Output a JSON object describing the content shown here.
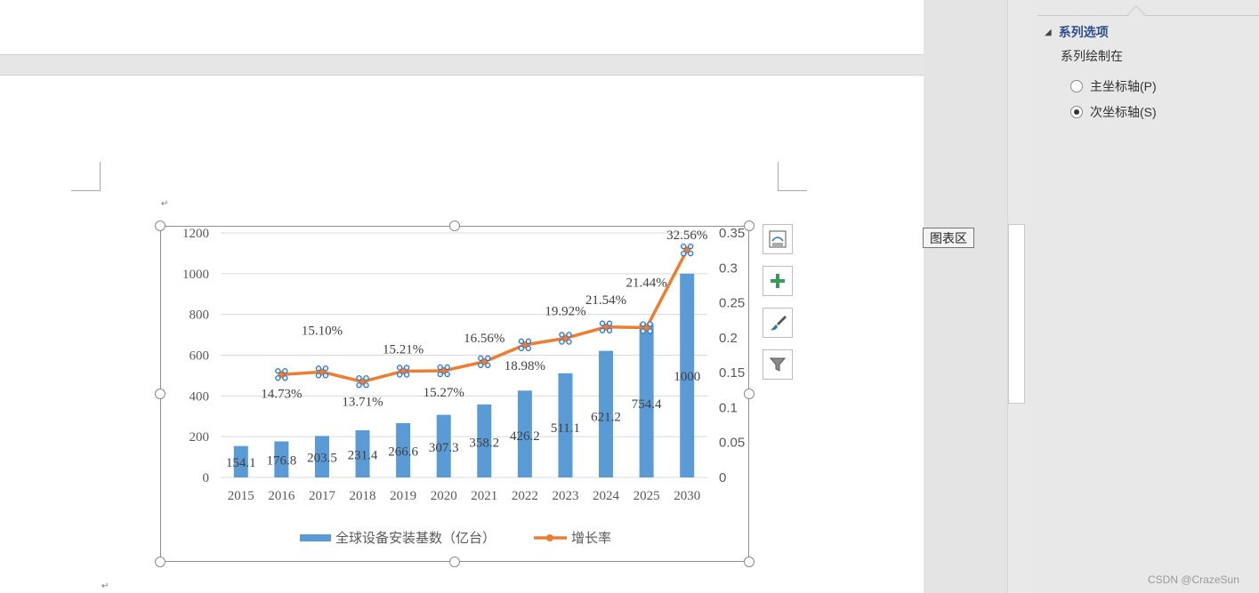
{
  "right_pane": {
    "section_title": "系列选项",
    "plot_on_label": "系列绘制在",
    "options": [
      {
        "label": "主坐标轴(P)",
        "selected": false
      },
      {
        "label": "次坐标轴(S)",
        "selected": true
      }
    ]
  },
  "tooltip": "图表区",
  "watermark": "CSDN @CrazeSun",
  "chart_toolbar": [
    "layout-options-icon",
    "plus-icon",
    "brush-icon",
    "filter-icon"
  ],
  "colors": {
    "bar": "#5b9bd5",
    "line": "#ed7d31",
    "grid": "#d9d9d9",
    "accent": "#2b4f8c"
  },
  "chart_data": {
    "type": "bar",
    "categories": [
      "2015",
      "2016",
      "2017",
      "2018",
      "2019",
      "2020",
      "2021",
      "2022",
      "2023",
      "2024",
      "2025",
      "2030"
    ],
    "series": [
      {
        "name": "全球设备安装基数（亿台）",
        "type": "bar",
        "axis": "primary",
        "values": [
          154.1,
          176.8,
          203.5,
          231.4,
          266.6,
          307.3,
          358.2,
          426.2,
          511.1,
          621.2,
          754.4,
          1000
        ],
        "labels": [
          "154.1",
          "176.8",
          "203.5",
          "231.4",
          "266.6",
          "307.3",
          "358.2",
          "426.2",
          "511.1",
          "621.2",
          "754.4",
          "1000"
        ]
      },
      {
        "name": "增长率",
        "type": "line",
        "axis": "secondary",
        "values": [
          null,
          0.1473,
          0.151,
          0.1371,
          0.1521,
          0.1527,
          0.1656,
          0.1898,
          0.1992,
          0.2154,
          0.2144,
          0.3256
        ],
        "labels": [
          "",
          "14.73%",
          "15.10%",
          "13.71%",
          "15.21%",
          "15.27%",
          "16.56%",
          "18.98%",
          "19.92%",
          "21.54%",
          "21.44%",
          "32.56%"
        ]
      }
    ],
    "y_ticks": [
      "0",
      "200",
      "400",
      "600",
      "800",
      "1000",
      "1200"
    ],
    "y2_ticks": [
      "0",
      "0.05",
      "0.1",
      "0.15",
      "0.2",
      "0.25",
      "0.3",
      "0.35"
    ],
    "ylim": [
      0,
      1200
    ],
    "y2lim": [
      0,
      0.35
    ],
    "grid": true,
    "legend_position": "bottom"
  }
}
